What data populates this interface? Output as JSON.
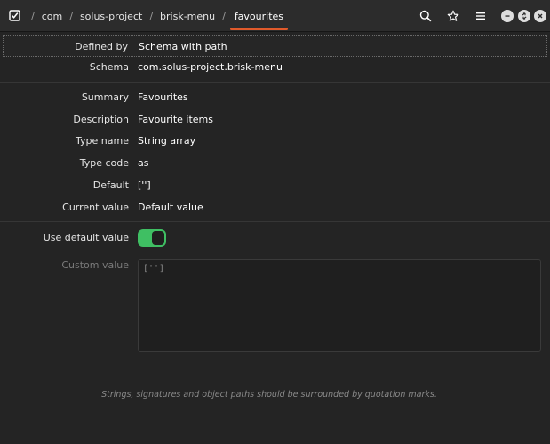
{
  "header": {
    "breadcrumbs": [
      "com",
      "solus-project",
      "brisk-menu"
    ],
    "separator": "/",
    "current": "favourites",
    "accent_color": "#e05a2b"
  },
  "icons": {
    "app": "checkbox-icon",
    "search": "search-icon",
    "bookmark": "star-icon",
    "menu": "hamburger-menu-icon",
    "minimize": "minimize-icon",
    "maximize": "restore-icon",
    "close": "close-icon"
  },
  "fields": {
    "defined_by": {
      "label": "Defined by",
      "value": "Schema with path"
    },
    "schema": {
      "label": "Schema",
      "value": "com.solus-project.brisk-menu"
    },
    "summary": {
      "label": "Summary",
      "value": "Favourites"
    },
    "description": {
      "label": "Description",
      "value": "Favourite items"
    },
    "type_name": {
      "label": "Type name",
      "value": "String array"
    },
    "type_code": {
      "label": "Type code",
      "value": "as"
    },
    "default": {
      "label": "Default",
      "value": "['']"
    },
    "current_value": {
      "label": "Current value",
      "value": "Default value"
    }
  },
  "use_default": {
    "label": "Use default value",
    "enabled": true,
    "color": "#3fbf63"
  },
  "custom_value": {
    "label": "Custom value",
    "text": "['']",
    "hint": "Strings, signatures and object paths should be surrounded by quotation marks."
  }
}
